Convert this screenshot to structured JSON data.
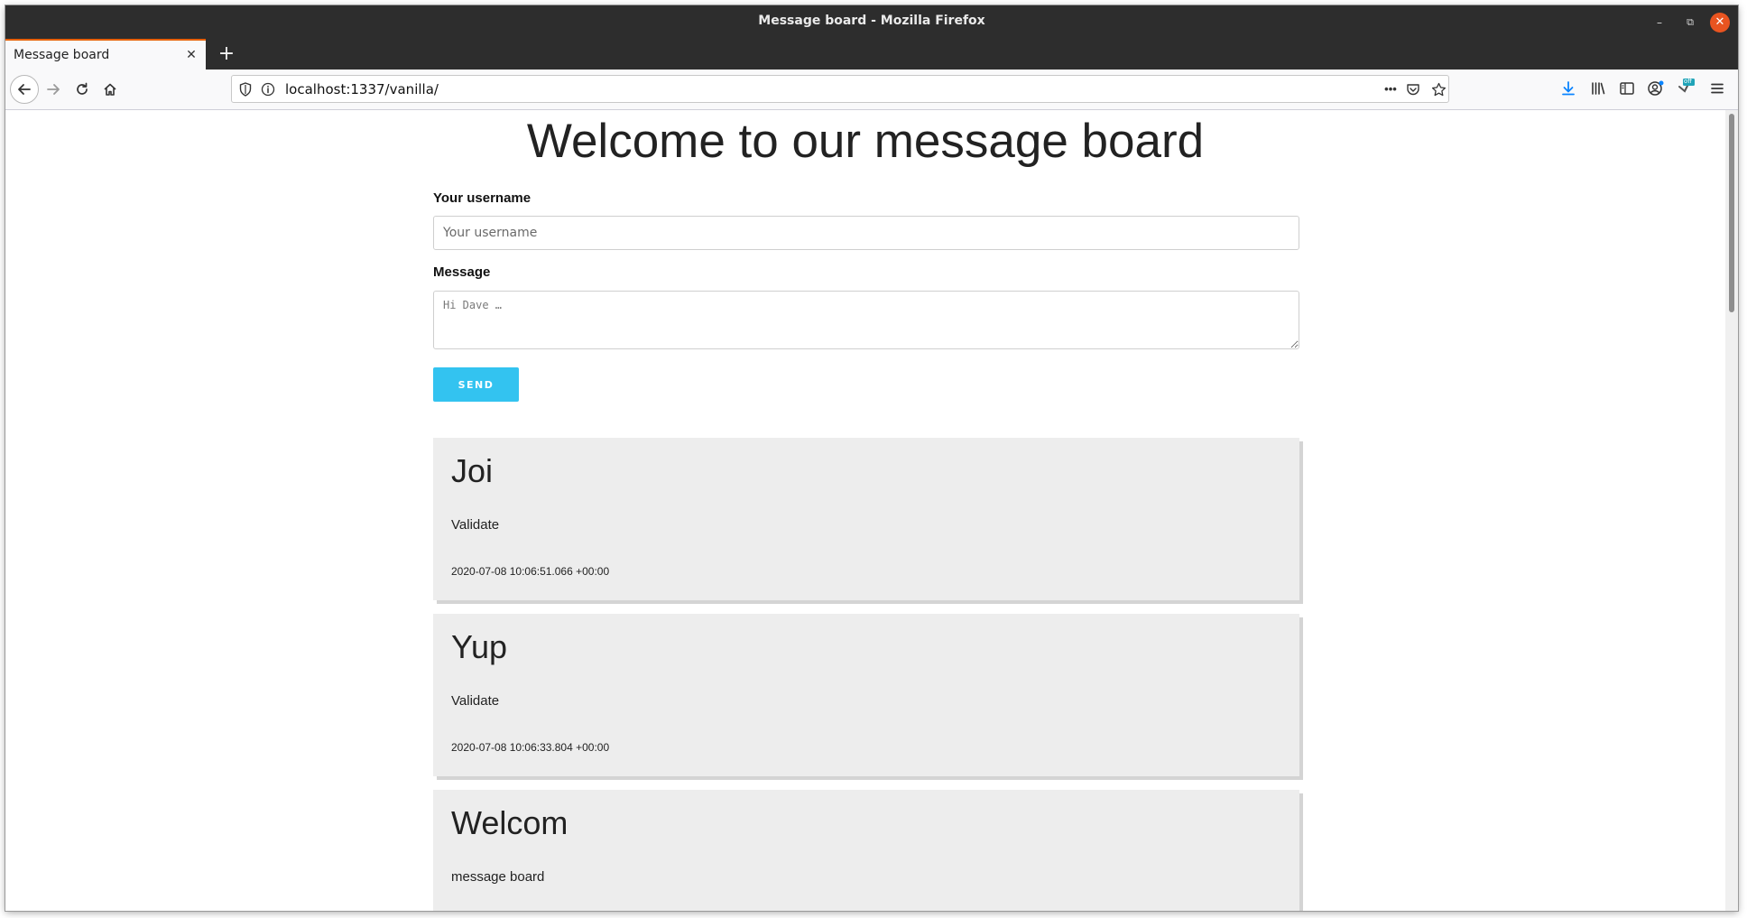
{
  "window": {
    "title": "Message board - Mozilla Firefox",
    "minimize_label": "–",
    "restore_label": "⧉",
    "close_label": "✕"
  },
  "tabs": [
    {
      "label": "Message board",
      "close_label": "✕"
    }
  ],
  "new_tab_label": "+",
  "urlbar": {
    "url": "localhost:1337/vanilla/",
    "more_label": "•••"
  },
  "toolbar_badge": "off",
  "page": {
    "title": "Welcome to our message board",
    "form": {
      "username_label": "Your username",
      "username_placeholder": "Your username",
      "username_value": "",
      "message_label": "Message",
      "message_placeholder": "Hi Dave …",
      "message_value": "",
      "send_label": "SEND"
    },
    "messages": [
      {
        "author": "Joi",
        "body": "Validate",
        "timestamp": "2020-07-08 10:06:51.066 +00:00"
      },
      {
        "author": "Yup",
        "body": "Validate",
        "timestamp": "2020-07-08 10:06:33.804 +00:00"
      },
      {
        "author": "Welcom",
        "body": "message board",
        "timestamp": ""
      }
    ]
  },
  "colors": {
    "accent_button": "#33c3f0",
    "tab_highlight": "#e66000",
    "card_background": "#ededed",
    "close_button": "#e95420"
  }
}
